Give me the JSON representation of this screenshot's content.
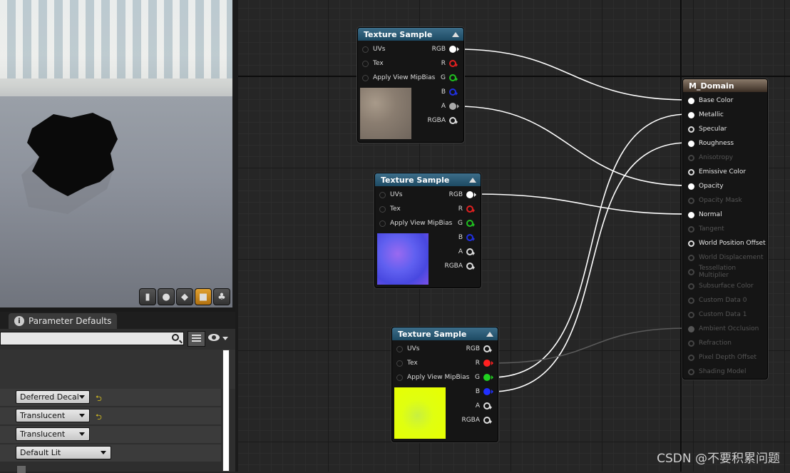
{
  "details": {
    "tab_label": "Parameter Defaults",
    "search_placeholder": "",
    "props": [
      {
        "value": "Deferred Decal",
        "reset": "⮌"
      },
      {
        "value": "Translucent",
        "reset": "⮌"
      },
      {
        "value": "Translucent",
        "reset": ""
      },
      {
        "value": "Default Lit",
        "reset": ""
      }
    ]
  },
  "nodes": [
    {
      "title": "Texture Sample",
      "inputs": [
        "UVs",
        "Tex",
        "Apply View MipBias"
      ],
      "outputs": [
        "RGB",
        "R",
        "G",
        "B",
        "A",
        "RGBA"
      ]
    },
    {
      "title": "Texture Sample",
      "inputs": [
        "UVs",
        "Tex",
        "Apply View MipBias"
      ],
      "outputs": [
        "RGB",
        "R",
        "G",
        "B",
        "A",
        "RGBA"
      ]
    },
    {
      "title": "Texture Sample",
      "inputs": [
        "UVs",
        "Tex",
        "Apply View MipBias"
      ],
      "outputs": [
        "RGB",
        "R",
        "G",
        "B",
        "A",
        "RGBA"
      ]
    }
  ],
  "material": {
    "title": "M_Domain",
    "pins": [
      {
        "label": "Base Color",
        "active": true,
        "connected": true
      },
      {
        "label": "Metallic",
        "active": true,
        "connected": true
      },
      {
        "label": "Specular",
        "active": true,
        "connected": false
      },
      {
        "label": "Roughness",
        "active": true,
        "connected": true
      },
      {
        "label": "Anisotropy",
        "active": false,
        "connected": false
      },
      {
        "label": "Emissive Color",
        "active": true,
        "connected": false
      },
      {
        "label": "Opacity",
        "active": true,
        "connected": true
      },
      {
        "label": "Opacity Mask",
        "active": false,
        "connected": false
      },
      {
        "label": "Normal",
        "active": true,
        "connected": true
      },
      {
        "label": "Tangent",
        "active": false,
        "connected": false
      },
      {
        "label": "World Position Offset",
        "active": true,
        "connected": false
      },
      {
        "label": "World Displacement",
        "active": false,
        "connected": false
      },
      {
        "label": "Tessellation Multiplier",
        "active": false,
        "connected": false
      },
      {
        "label": "Subsurface Color",
        "active": false,
        "connected": false
      },
      {
        "label": "Custom Data 0",
        "active": false,
        "connected": false
      },
      {
        "label": "Custom Data 1",
        "active": false,
        "connected": false
      },
      {
        "label": "Ambient Occlusion",
        "active": false,
        "connected": true
      },
      {
        "label": "Refraction",
        "active": false,
        "connected": false
      },
      {
        "label": "Pixel Depth Offset",
        "active": false,
        "connected": false
      },
      {
        "label": "Shading Model",
        "active": false,
        "connected": false
      }
    ]
  },
  "watermark": "CSDN @不要积累问题",
  "colors": {
    "r": "#ff2020",
    "g": "#20d020",
    "b": "#2030ff",
    "white": "#ffffff"
  }
}
